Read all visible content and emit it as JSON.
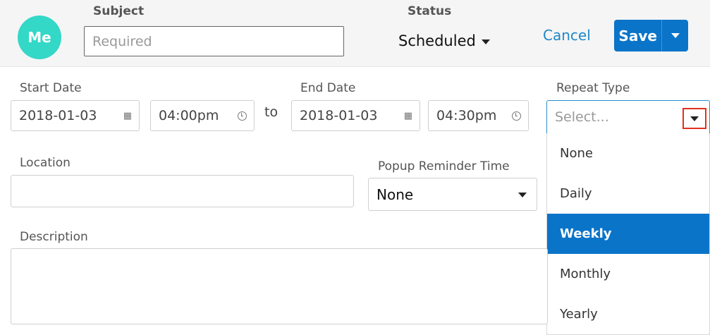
{
  "header": {
    "avatar_text": "Me",
    "subject_label": "Subject",
    "subject_placeholder": "Required",
    "status_label": "Status",
    "status_value": "Scheduled",
    "cancel_label": "Cancel",
    "save_label": "Save"
  },
  "dates": {
    "start_label": "Start Date",
    "start_date": "2018-01-03",
    "start_time": "04:00pm",
    "to_text": "to",
    "end_label": "End Date",
    "end_date": "2018-01-03",
    "end_time": "04:30pm"
  },
  "repeat": {
    "label": "Repeat Type",
    "placeholder": "Select...",
    "options": [
      "None",
      "Daily",
      "Weekly",
      "Monthly",
      "Yearly"
    ],
    "selected_option": "Weekly",
    "highlight_color": "#e0321f"
  },
  "location": {
    "label": "Location",
    "value": ""
  },
  "popup_reminder": {
    "label": "Popup Reminder Time",
    "value": "None"
  },
  "description": {
    "label": "Description",
    "value": ""
  },
  "colors": {
    "accent": "#0a74c9",
    "avatar": "#33d8c7",
    "link": "#1e88c7"
  }
}
